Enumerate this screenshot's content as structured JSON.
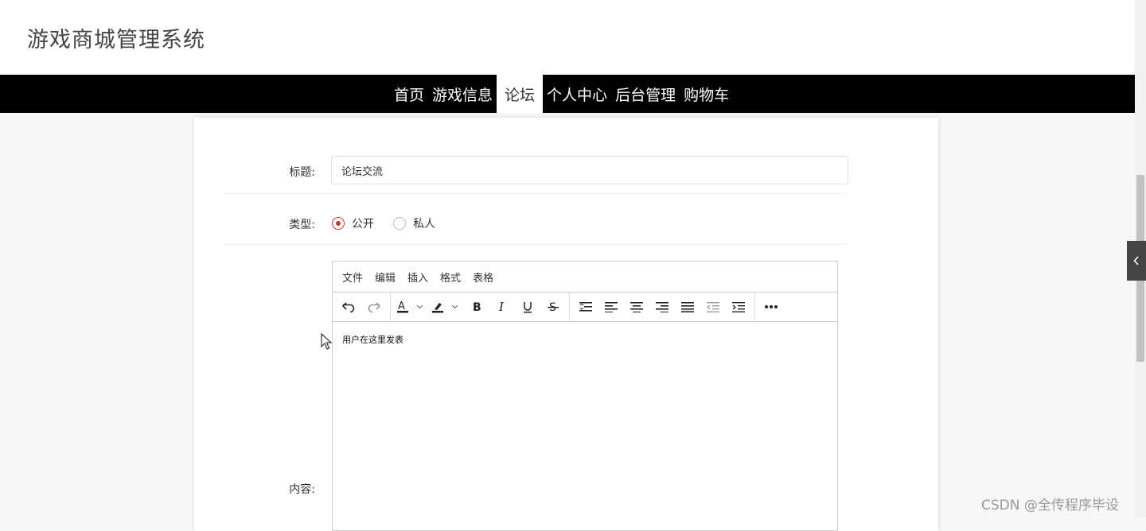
{
  "header": {
    "site_title": "游戏商城管理系统"
  },
  "nav": {
    "items": [
      {
        "label": "首页",
        "active": false
      },
      {
        "label": "游戏信息",
        "active": false
      },
      {
        "label": "论坛",
        "active": true
      },
      {
        "label": "个人中心",
        "active": false
      },
      {
        "label": "后台管理",
        "active": false
      },
      {
        "label": "购物车",
        "active": false
      }
    ]
  },
  "form": {
    "title_label": "标题:",
    "title_value": "论坛交流",
    "type_label": "类型:",
    "type_options": [
      {
        "label": "公开",
        "checked": true
      },
      {
        "label": "私人",
        "checked": false
      }
    ],
    "content_label": "内容:"
  },
  "editor": {
    "menus": [
      "文件",
      "编辑",
      "插入",
      "格式",
      "表格"
    ],
    "toolbar_icons": [
      "undo-icon",
      "redo-icon",
      "text-color-icon",
      "highlight-color-icon",
      "bold-icon",
      "italic-icon",
      "underline-icon",
      "strikethrough-icon",
      "line-height-icon",
      "align-left-icon",
      "align-center-icon",
      "align-right-icon",
      "align-justify-icon",
      "outdent-icon",
      "indent-icon",
      "more-icon"
    ],
    "content": "用户在这里发表"
  },
  "colors": {
    "navbar_bg": "#000000",
    "radio_accent": "#c0392b"
  },
  "watermark": "CSDN @全传程序毕设"
}
